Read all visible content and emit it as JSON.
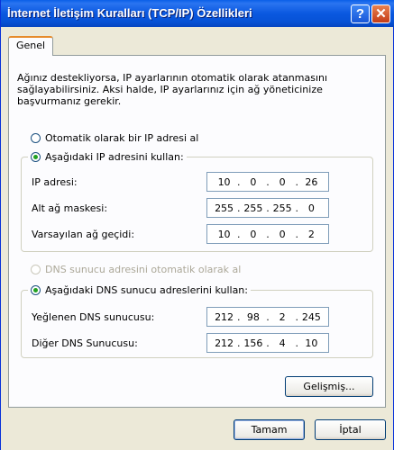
{
  "window": {
    "title": "İnternet İletişim Kuralları (TCP/IP) Özellikleri",
    "help_label": "?",
    "close_label": "✕"
  },
  "tabs": [
    {
      "label": "Genel",
      "active": true
    }
  ],
  "intro": {
    "line1": "Ağınız destekliyorsa, IP ayarlarının otomatik olarak atanmasını",
    "line2": "sağlayabilirsiniz. Aksi halde, IP ayarlarınız için ağ yöneticinize",
    "line3": "başvurmanız gerekir."
  },
  "ip": {
    "auto_label": "Otomatik olarak bir IP adresi al",
    "manual_label": "Aşağıdaki IP adresini kullan:",
    "selected": "manual",
    "fields": [
      {
        "label": "IP adresi:",
        "octets": [
          "10",
          "0",
          "0",
          "26"
        ]
      },
      {
        "label": "Alt ağ maskesi:",
        "octets": [
          "255",
          "255",
          "255",
          "0"
        ]
      },
      {
        "label": "Varsayılan ağ geçidi:",
        "octets": [
          "10",
          "0",
          "0",
          "2"
        ]
      }
    ]
  },
  "dns": {
    "auto_label": "DNS sunucu adresini otomatik olarak al",
    "manual_label": "Aşağıdaki DNS sunucu adreslerini kullan:",
    "selected": "manual",
    "fields": [
      {
        "label": "Yeğlenen DNS sunucusu:",
        "octets": [
          "212",
          "98",
          "2",
          "245"
        ]
      },
      {
        "label": "Diğer DNS Sunucusu:",
        "octets": [
          "212",
          "156",
          "4",
          "10"
        ]
      }
    ]
  },
  "buttons": {
    "advanced": "Gelişmiş...",
    "ok": "Tamam",
    "cancel": "İptal"
  },
  "colors": {
    "title_bar": "#0a58e0",
    "dialog_bg": "#ece9d8",
    "radio_dot": "#21a121"
  }
}
